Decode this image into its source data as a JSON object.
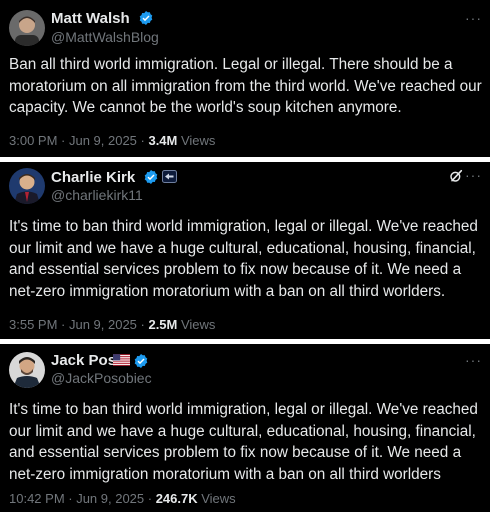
{
  "tweets": [
    {
      "name": "Matt Walsh",
      "handle": "@MattWalshBlog",
      "text": "Ban all third world immigration. Legal or illegal. There should be a moratorium on all immigration from the third world. We've reached our capacity. We cannot be the world's soup kitchen anymore.",
      "time": "3:00 PM · Jun 9, 2025 · ",
      "views_count": "3.4M",
      "views_label": " Views",
      "more": "···"
    },
    {
      "name": "Charlie Kirk",
      "handle": "@charliekirk11",
      "text": "It's time to ban third world immigration, legal or illegal. We've reached our limit and we have a huge cultural, educational, housing, financial, and essential services problem to fix now because of it. We need a net-zero immigration moratorium with a ban on all third worlders.",
      "time": "3:55 PM · Jun 9, 2025 · ",
      "views_count": "2.5M",
      "views_label": " Views",
      "more": "···"
    },
    {
      "name": "Jack Poso",
      "handle": "@JackPosobiec",
      "text": "It's time to ban third world immigration, legal or illegal. We've reached our limit and we have a huge cultural, educational, housing, financial, and essential services problem to fix now because of it. We need a net-zero immigration moratorium with a ban on all third worlders",
      "time": "10:42 PM · Jun 9, 2025 · ",
      "views_count": "246.7K",
      "views_label": " Views",
      "more": "···"
    }
  ],
  "colors": {
    "background": "#000000",
    "verified_badge": "#1d9bf0",
    "secondary_text": "#71767b"
  },
  "icons": [
    "verified-badge-icon",
    "affiliate-badge-icon",
    "us-flag-icon",
    "grok-icon",
    "more-icon"
  ]
}
